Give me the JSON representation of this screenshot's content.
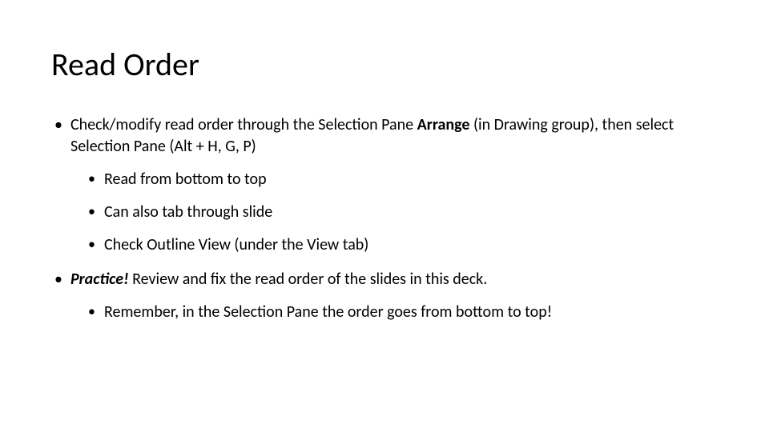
{
  "slide": {
    "title": "Read Order",
    "b1_pre": "Check/modify read order through the Selection Pane ",
    "b1_bold": "Arrange",
    "b1_post": " (in Drawing group), then select Selection Pane (Alt + H, G, P)",
    "b1_sub1": "Read from bottom to top",
    "b1_sub2": "Can also tab through slide",
    "b1_sub3": "Check Outline View (under the View tab)",
    "b2_emph": "Practice!",
    "b2_rest": "  Review and fix the read order of the slides in this deck.",
    "b2_sub1": "Remember, in the Selection Pane the order goes from bottom to top!"
  }
}
